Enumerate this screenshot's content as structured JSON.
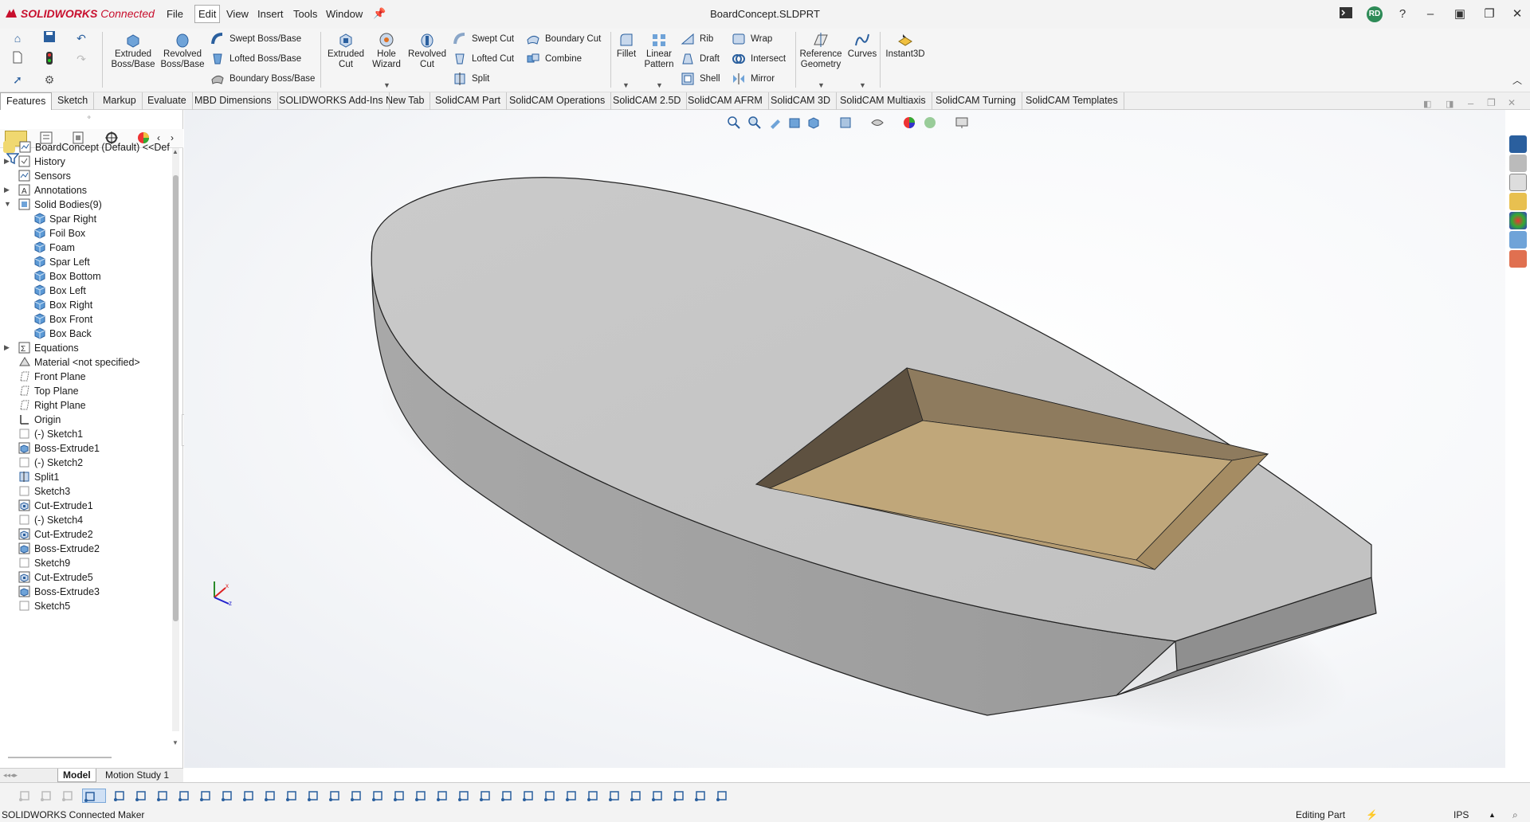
{
  "app": {
    "logo_brand": "SOLIDWORKS",
    "logo_suffix": "Connected"
  },
  "menu": [
    "File",
    "Edit",
    "View",
    "Insert",
    "Tools",
    "Window"
  ],
  "document_title": "BoardConcept.SLDPRT",
  "user_initials": "RD",
  "ribbon": {
    "extruded_boss": "Extruded\nBoss/Base",
    "revolved_boss": "Revolved\nBoss/Base",
    "swept_boss": "Swept Boss/Base",
    "lofted_boss": "Lofted Boss/Base",
    "boundary_boss": "Boundary Boss/Base",
    "extruded_cut": "Extruded\nCut",
    "hole_wizard": "Hole\nWizard",
    "revolved_cut": "Revolved\nCut",
    "swept_cut": "Swept Cut",
    "lofted_cut": "Lofted Cut",
    "boundary_cut": "Boundary Cut",
    "combine": "Combine",
    "split": "Split",
    "fillet": "Fillet",
    "linear_pattern": "Linear\nPattern",
    "rib": "Rib",
    "draft": "Draft",
    "shell": "Shell",
    "wrap": "Wrap",
    "intersect": "Intersect",
    "mirror": "Mirror",
    "reference_geometry": "Reference\nGeometry",
    "curves": "Curves",
    "instant3d": "Instant3D"
  },
  "tabs": [
    "Features",
    "Sketch",
    "Markup",
    "Evaluate",
    "MBD Dimensions",
    "SOLIDWORKS Add-Ins",
    "New Tab",
    "SolidCAM Part",
    "SolidCAM Operations",
    "SolidCAM 2.5D",
    "SolidCAM AFRM",
    "SolidCAM 3D",
    "SolidCAM Multiaxis",
    "SolidCAM Turning",
    "SolidCAM Templates"
  ],
  "tree": {
    "root": "BoardConcept (Default) <<Def",
    "items": [
      {
        "label": "History",
        "icon": "history-icon",
        "expander": "right"
      },
      {
        "label": "Sensors",
        "icon": "sensors-icon",
        "expander": ""
      },
      {
        "label": "Annotations",
        "icon": "annotations-icon",
        "expander": "right"
      },
      {
        "label": "Solid Bodies(9)",
        "icon": "solid-bodies-icon",
        "expander": "down"
      },
      {
        "label": "Spar Right",
        "icon": "body-icon",
        "indent": 1
      },
      {
        "label": "Foil Box",
        "icon": "body-icon",
        "indent": 1
      },
      {
        "label": "Foam",
        "icon": "body-icon",
        "indent": 1
      },
      {
        "label": "Spar Left",
        "icon": "body-icon",
        "indent": 1
      },
      {
        "label": "Box Bottom",
        "icon": "body-icon",
        "indent": 1
      },
      {
        "label": "Box Left",
        "icon": "body-icon",
        "indent": 1
      },
      {
        "label": "Box Right",
        "icon": "body-icon",
        "indent": 1
      },
      {
        "label": "Box Front",
        "icon": "body-icon",
        "indent": 1
      },
      {
        "label": "Box Back",
        "icon": "body-icon",
        "indent": 1
      },
      {
        "label": "Equations",
        "icon": "equations-icon",
        "expander": "right"
      },
      {
        "label": "Material <not specified>",
        "icon": "material-icon"
      },
      {
        "label": "Front Plane",
        "icon": "plane-icon"
      },
      {
        "label": "Top Plane",
        "icon": "plane-icon"
      },
      {
        "label": "Right Plane",
        "icon": "plane-icon"
      },
      {
        "label": "Origin",
        "icon": "origin-icon"
      },
      {
        "label": "(-) Sketch1",
        "icon": "sketch-icon"
      },
      {
        "label": "Boss-Extrude1",
        "icon": "extrude-icon"
      },
      {
        "label": "(-) Sketch2",
        "icon": "sketch-icon"
      },
      {
        "label": "Split1",
        "icon": "split-icon"
      },
      {
        "label": "Sketch3",
        "icon": "sketch-icon"
      },
      {
        "label": "Cut-Extrude1",
        "icon": "cut-icon"
      },
      {
        "label": "(-) Sketch4",
        "icon": "sketch-icon"
      },
      {
        "label": "Cut-Extrude2",
        "icon": "cut-icon"
      },
      {
        "label": "Boss-Extrude2",
        "icon": "extrude-icon"
      },
      {
        "label": "Sketch9",
        "icon": "sketch-icon"
      },
      {
        "label": "Cut-Extrude5",
        "icon": "cut-icon"
      },
      {
        "label": "Boss-Extrude3",
        "icon": "extrude-icon"
      },
      {
        "label": "Sketch5",
        "icon": "sketch-icon"
      }
    ]
  },
  "bottom_tabs": [
    "Model",
    "Motion Study 1"
  ],
  "status": {
    "left": "SOLIDWORKS Connected Maker",
    "mode": "Editing Part",
    "units": "IPS"
  },
  "colors": {
    "brand": "#c8102e",
    "model_face": "#c6c6c6",
    "pocket": "#b59c72"
  }
}
